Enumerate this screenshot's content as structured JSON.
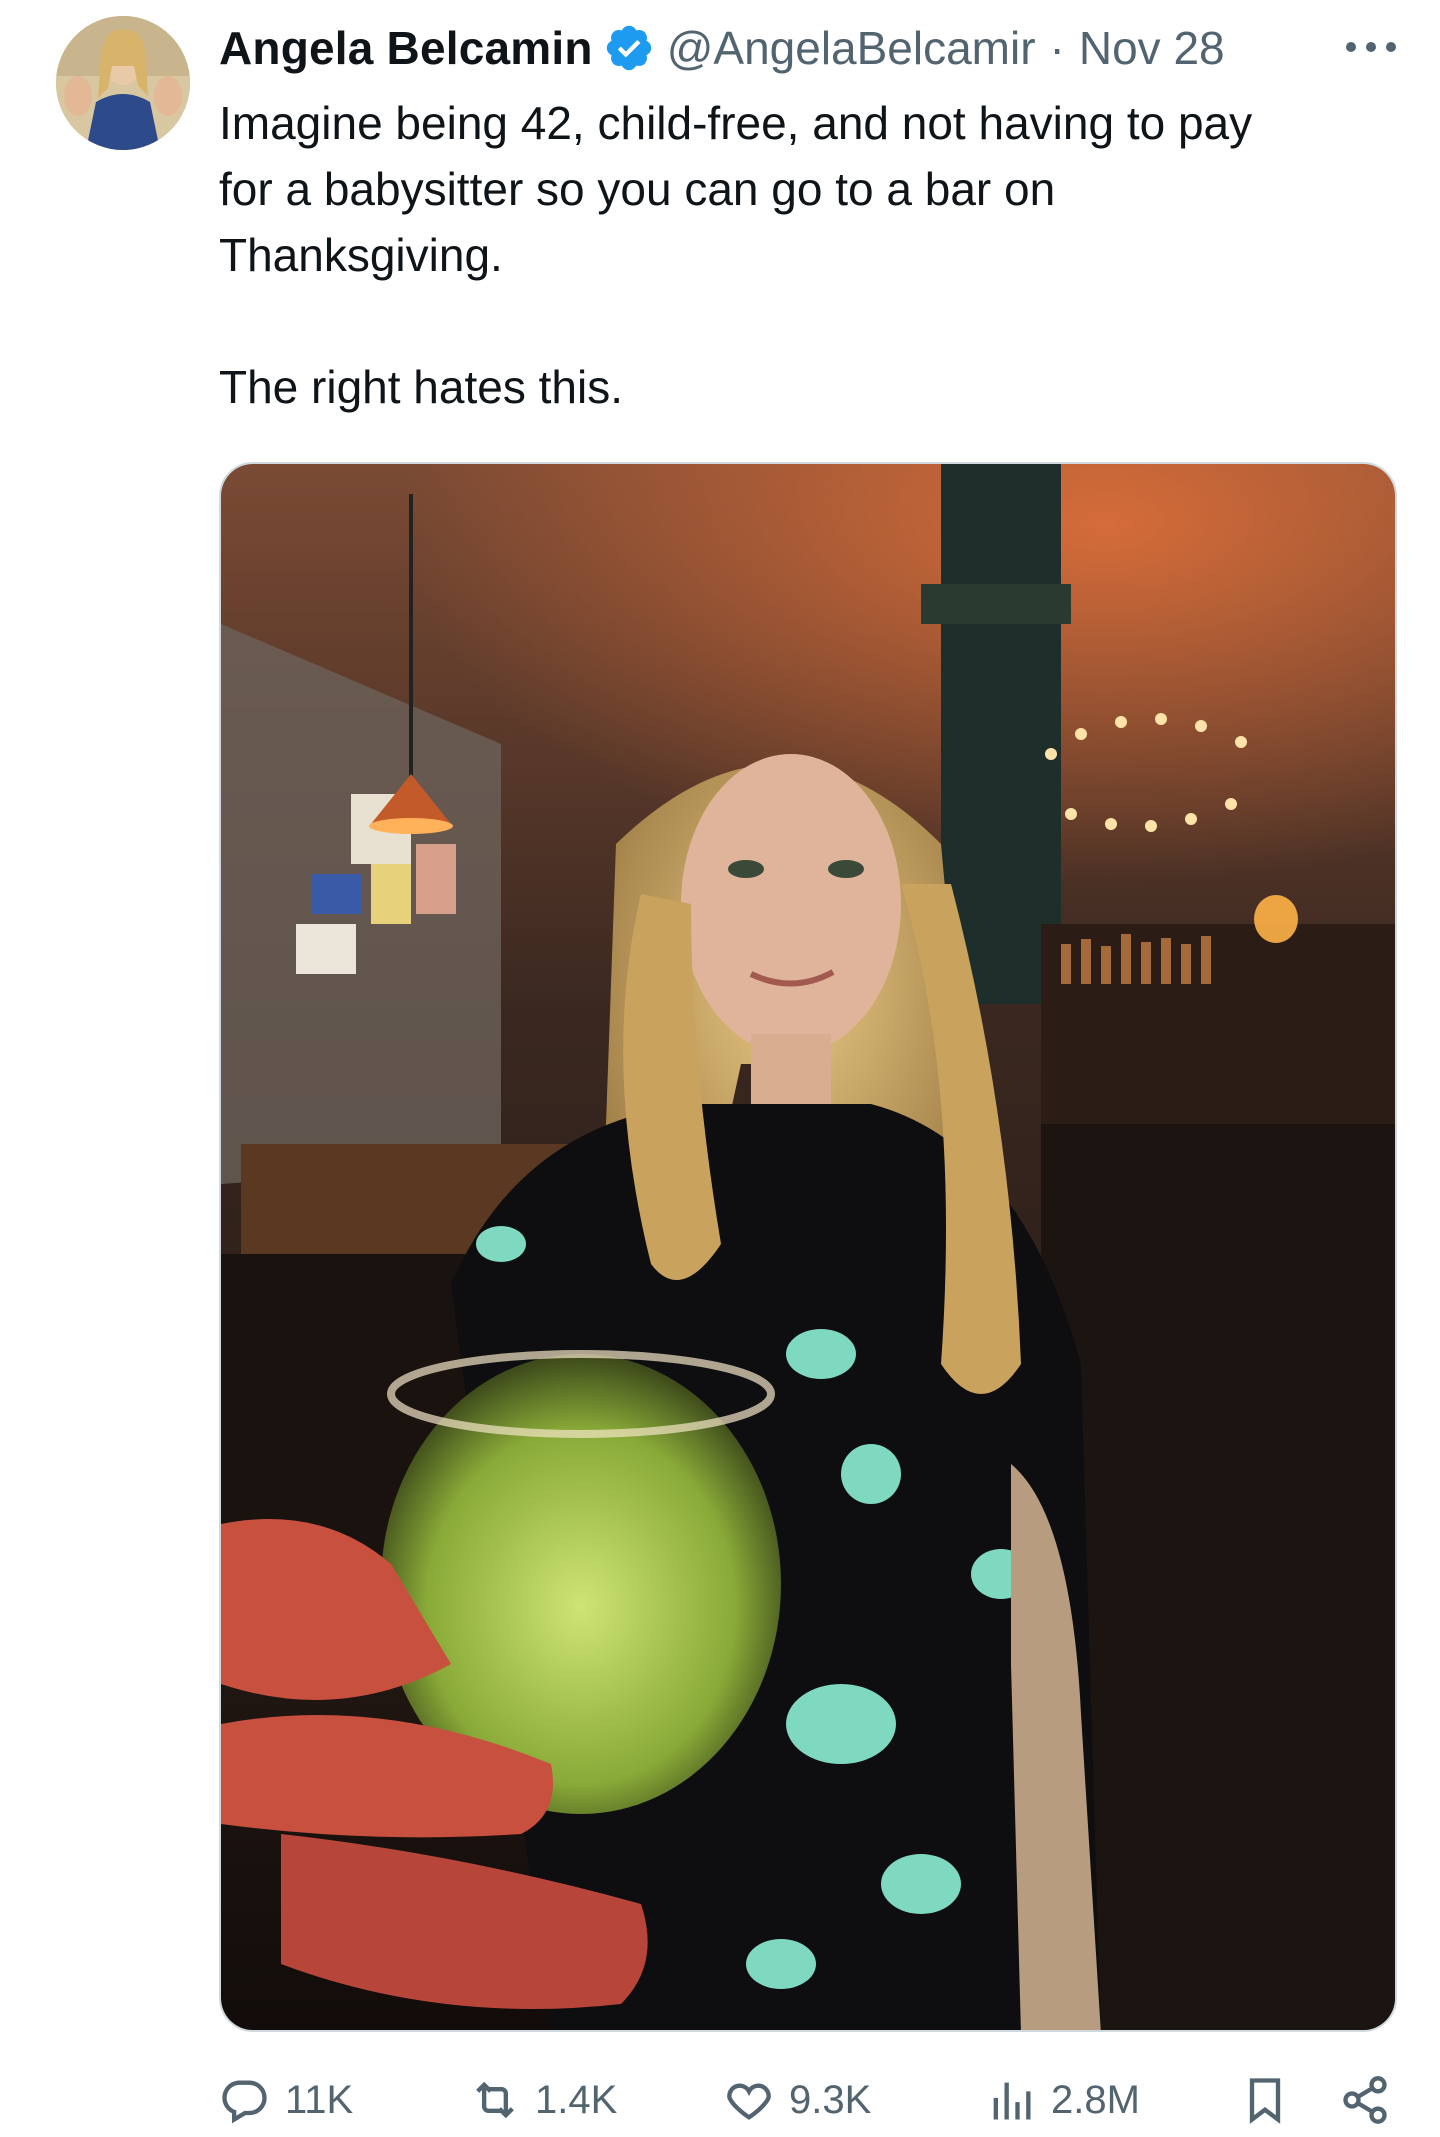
{
  "author": {
    "display_name": "Angela Belcamin",
    "handle": "@AngelaBelcamir",
    "separator": "·",
    "date": "Nov 28",
    "verified": true
  },
  "tweet": {
    "lines": [
      "Imagine being 42, child-free, and not having to pay",
      "for a babysitter so you can go to a bar on",
      "Thanksgiving."
    ],
    "second_paragraph": "The right hates this."
  },
  "metrics": {
    "replies": "11K",
    "reposts": "1.4K",
    "likes": "9.3K",
    "views": "2.8M"
  },
  "icons": {
    "verified": "verified-badge-icon",
    "more": "more-dots-icon",
    "reply": "reply-icon",
    "repost": "repost-icon",
    "like": "heart-icon",
    "views": "views-chart-icon",
    "bookmark": "bookmark-icon",
    "share": "share-icon"
  },
  "colors": {
    "text": "#0f1419",
    "muted": "#536471",
    "verified_blue": "#1d9bf0",
    "border": "#cfd9de"
  }
}
